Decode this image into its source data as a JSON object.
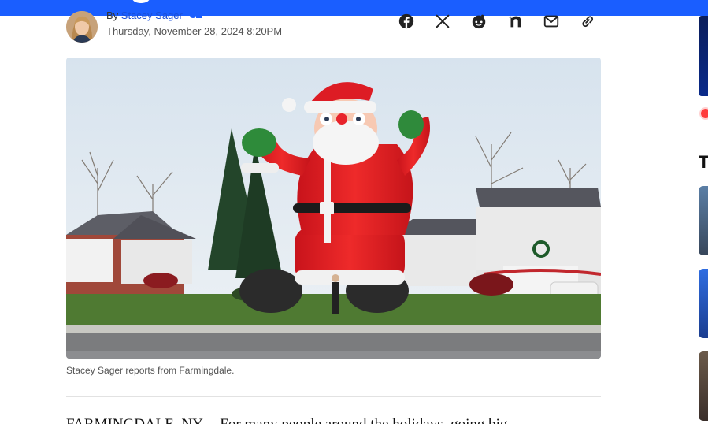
{
  "article": {
    "byline_prefix": "By",
    "author": "Stacey Sager",
    "date": "Thursday, November 28, 2024 8:20PM",
    "image_caption": "Stacey Sager reports from Farmingdale.",
    "lead_text": "FARMINGDALE, NY -- For many people around the holidays, going big"
  },
  "share": [
    {
      "icon": "facebook-icon"
    },
    {
      "icon": "x-icon"
    },
    {
      "icon": "reddit-icon"
    },
    {
      "icon": "nextdoor-icon"
    },
    {
      "icon": "email-icon"
    },
    {
      "icon": "link-icon"
    }
  ],
  "sidebar": {
    "heading_initial": "T"
  },
  "colors": {
    "brand": "#1a5eff",
    "live_dot": "#ff3b3b"
  }
}
